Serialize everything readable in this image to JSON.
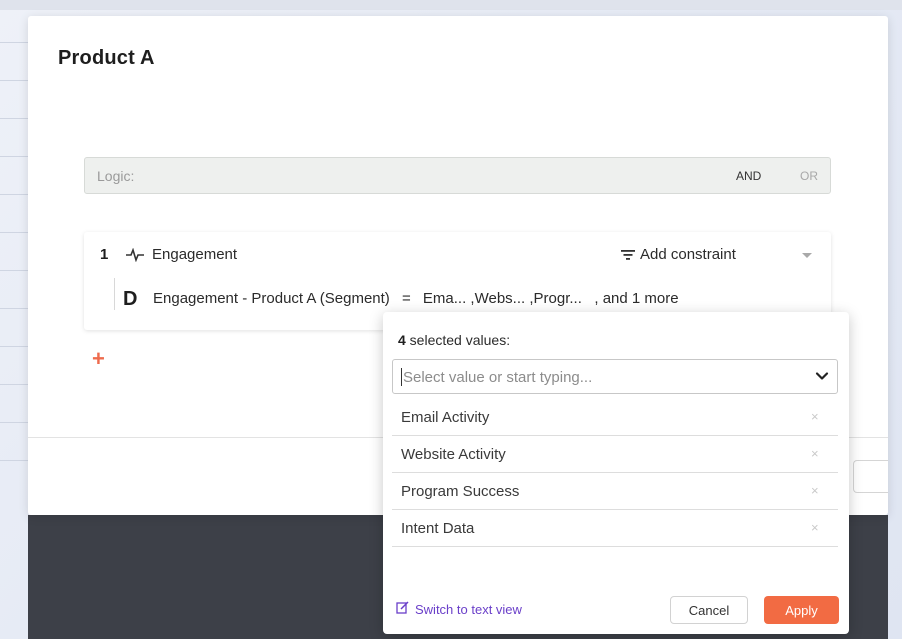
{
  "modal": {
    "title": "Product A",
    "logic": {
      "label": "Logic:",
      "and_label": "AND",
      "or_label": "OR"
    }
  },
  "rule": {
    "number": "1",
    "name": "Engagement",
    "icon": "pulse-icon",
    "add_constraint_label": "Add constraint",
    "condition": {
      "icon": "d-segment-icon",
      "field": "Engagement - Product A (Segment)",
      "operator": "=",
      "values_summary": "Ema... ,Webs... ,Progr...   , and 1 more"
    },
    "add_rule_symbol": "+"
  },
  "value_picker": {
    "count": "4",
    "count_suffix": " selected values:",
    "placeholder": "Select value or start typing...",
    "items": [
      {
        "label": "Email Activity",
        "remove": "×"
      },
      {
        "label": "Website Activity",
        "remove": "×"
      },
      {
        "label": "Program Success",
        "remove": "×"
      },
      {
        "label": "Intent Data",
        "remove": "×"
      }
    ],
    "switch_label": "Switch to text view",
    "cancel_label": "Cancel",
    "apply_label": "Apply"
  },
  "colors": {
    "accent": "#f26b43",
    "link": "#6a3fc9",
    "overlay": "#3d4048"
  }
}
